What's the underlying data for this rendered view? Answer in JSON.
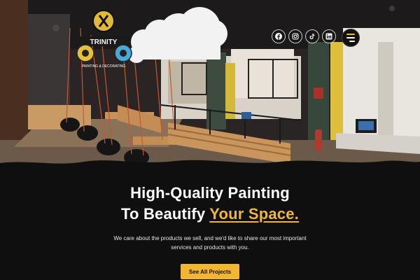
{
  "brand": {
    "name": "TRINITY",
    "tagline": "PAINTING & DECORATING"
  },
  "social": [
    {
      "name": "facebook",
      "icon": "facebook-icon"
    },
    {
      "name": "instagram",
      "icon": "instagram-icon"
    },
    {
      "name": "tiktok",
      "icon": "tiktok-icon"
    },
    {
      "name": "linkedin",
      "icon": "linkedin-icon"
    }
  ],
  "menu": {
    "icon": "hamburger-menu-icon"
  },
  "hero": {
    "heading_line1": "High-Quality Painting",
    "heading_line2_prefix": "To Beautify ",
    "heading_line2_highlight": "Your Space.",
    "description": "We care about the products we sell, and we'd like to share our most important services and products with you.",
    "cta_label": "See All Projects"
  },
  "colors": {
    "accent": "#f2b632",
    "background": "#0f0f0f",
    "text": "#ffffff"
  }
}
